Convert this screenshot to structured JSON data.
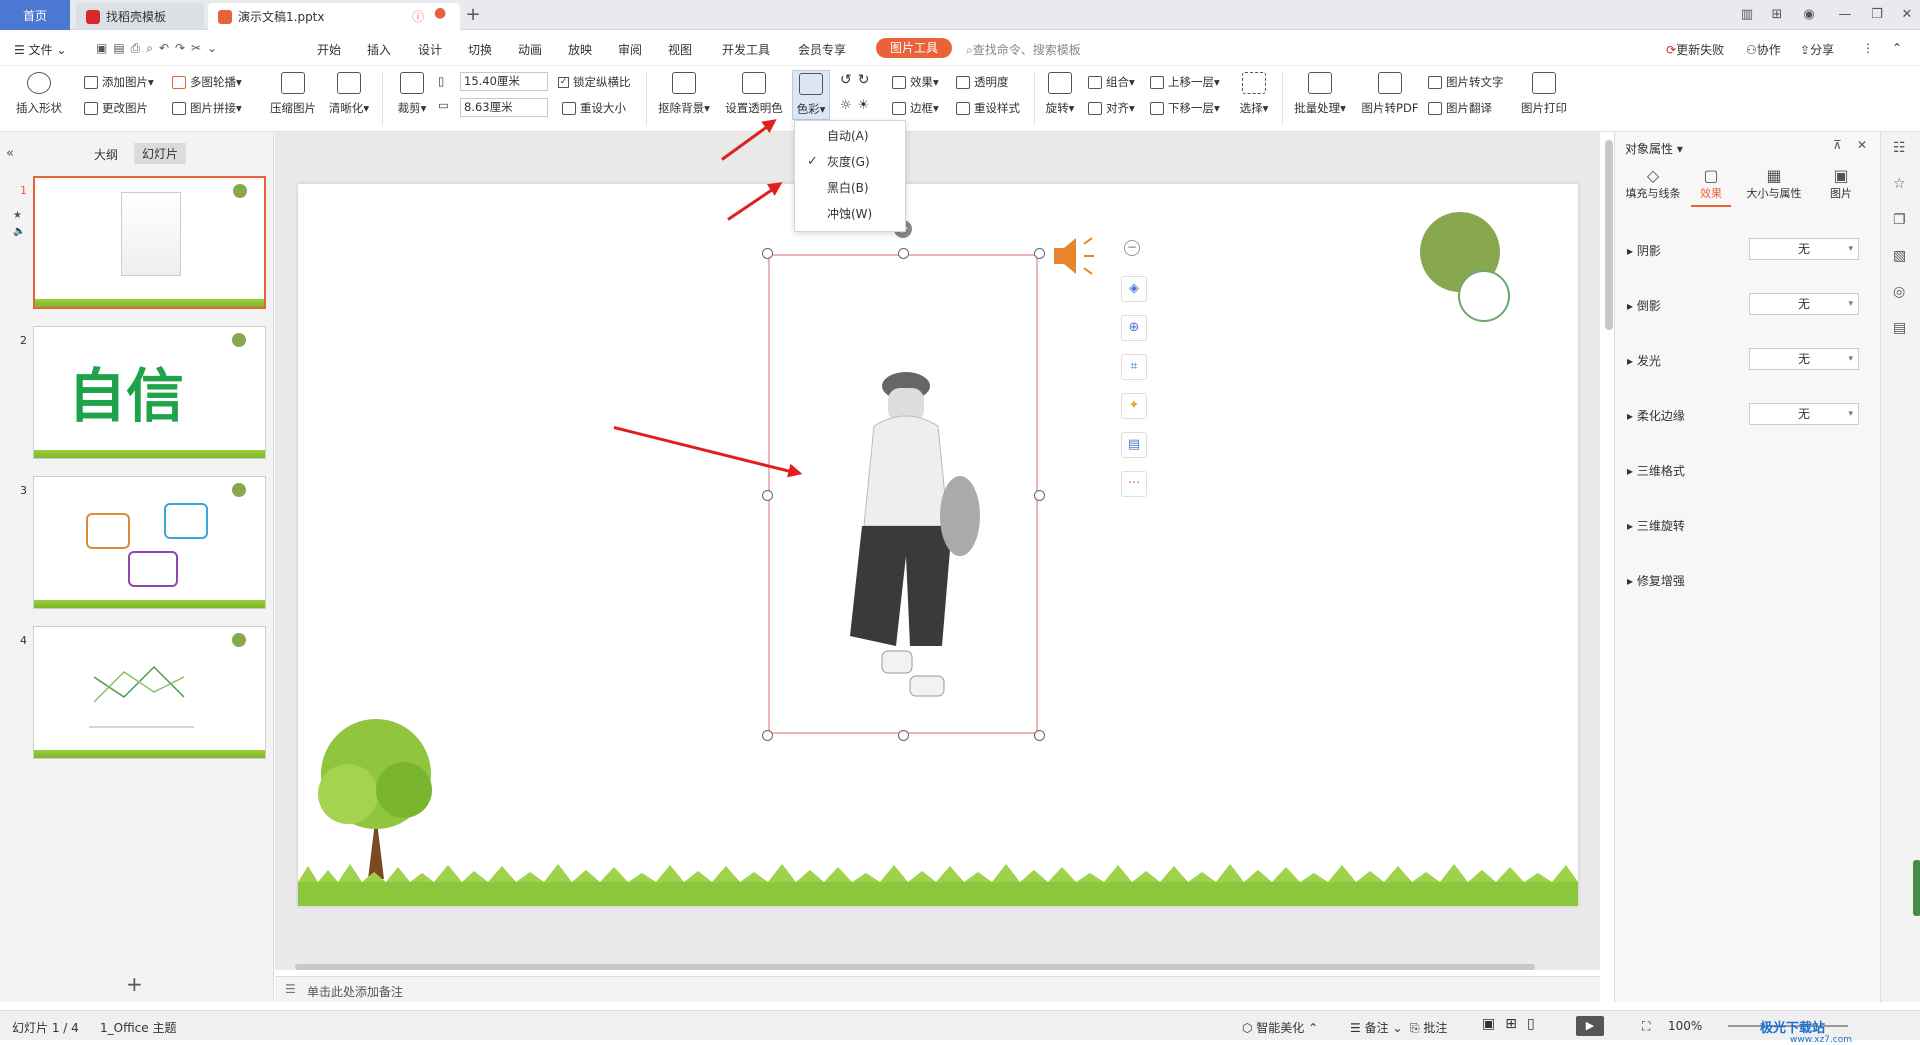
{
  "tabs": {
    "home": "首页",
    "template": "找稻壳模板",
    "document": "演示文稿1.pptx"
  },
  "menu": {
    "file": "文件",
    "items": [
      "开始",
      "插入",
      "设计",
      "切换",
      "动画",
      "放映",
      "审阅",
      "视图",
      "开发工具",
      "会员专享"
    ],
    "picture_tools": "图片工具",
    "search_placeholder": "查找命令、搜索模板",
    "update_failed": "更新失败",
    "collaborate": "协作",
    "share": "分享"
  },
  "ribbon": {
    "insert_shape": "插入形状",
    "add_picture": "添加图片",
    "change_picture": "更改图片",
    "multi_carousel": "多图轮播",
    "picture_collage": "图片拼接",
    "compress_picture": "压缩图片",
    "sharpen": "清晰化",
    "crop": "裁剪",
    "width_value": "15.40厘米",
    "height_value": "8.63厘米",
    "lock_ratio": "锁定纵横比",
    "reset_size": "重设大小",
    "remove_background": "抠除背景",
    "set_transparent": "设置透明色",
    "color": "色彩",
    "effects": "效果",
    "transparency": "透明度",
    "border": "边框",
    "reset_style": "重设样式",
    "rotate": "旋转",
    "group": "组合",
    "align": "对齐",
    "bring_forward": "上移一层",
    "send_backward": "下移一层",
    "select": "选择",
    "batch_process": "批量处理",
    "pic_to_pdf": "图片转PDF",
    "pic_to_text": "图片转文字",
    "pic_translate": "图片翻译",
    "pic_print": "图片打印"
  },
  "color_menu": {
    "auto": "自动(A)",
    "grayscale": "灰度(G)",
    "black_white": "黑白(B)",
    "washout": "冲蚀(W)",
    "checked": "grayscale"
  },
  "left_panel": {
    "outline_tab": "大纲",
    "slides_tab": "幻灯片",
    "slides": [
      {
        "num": "1"
      },
      {
        "num": "2",
        "text": "自信"
      },
      {
        "num": "3"
      },
      {
        "num": "4"
      }
    ]
  },
  "notes_placeholder": "单击此处添加备注",
  "right_panel": {
    "title": "对象属性",
    "tabs": [
      "填充与线条",
      "效果",
      "大小与属性",
      "图片"
    ],
    "active_tab": "效果",
    "properties": [
      {
        "label": "阴影",
        "value": "无"
      },
      {
        "label": "倒影",
        "value": "无"
      },
      {
        "label": "发光",
        "value": "无"
      },
      {
        "label": "柔化边缘",
        "value": "无"
      },
      {
        "label": "三维格式"
      },
      {
        "label": "三维旋转"
      },
      {
        "label": "修复增强"
      }
    ]
  },
  "status": {
    "slide_count": "幻灯片 1 / 4",
    "theme": "1_Office 主题",
    "smart_beautify": "智能美化",
    "notes": "备注",
    "comments": "批注",
    "zoom": "100%"
  },
  "watermark": {
    "brand": "极光下载站",
    "url": "www.xz7.com"
  },
  "colors": {
    "accent": "#e8623a",
    "home_tab": "#4a78d2",
    "arrow": "#e0201f",
    "circle_green": "#88a84f"
  }
}
